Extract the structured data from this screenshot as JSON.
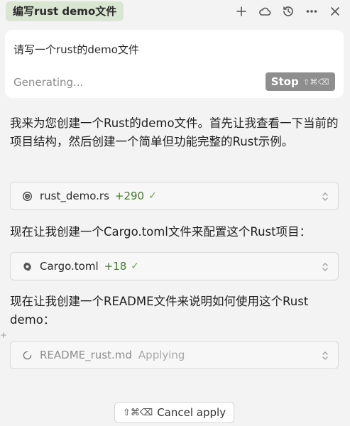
{
  "header": {
    "title": "编写rust demo文件",
    "icons": [
      "plus-icon",
      "cloud-icon",
      "history-icon",
      "more-icon",
      "close-icon"
    ]
  },
  "prompt": {
    "text": "请写一个rust的demo文件",
    "status": "Generating...",
    "stop_label": "Stop",
    "stop_shortcut": "⇧⌘⌫"
  },
  "messages": [
    "我来为您创建一个Rust的demo文件。首先让我查看一下当前的项目结构，然后创建一个简单但功能完整的Rust示例。",
    "现在让我创建一个Cargo.toml文件来配置这个Rust项目：",
    "现在让我创建一个README文件来说明如何使用这个Rust demo："
  ],
  "files": [
    {
      "name": "rust_demo.rs",
      "diff": "+290",
      "check": "✓",
      "icon": "rust-icon"
    },
    {
      "name": "Cargo.toml",
      "diff": "+18",
      "check": "✓",
      "icon": "gear-icon"
    },
    {
      "name": "README_rust.md",
      "status": "Applying",
      "icon": "loading-icon"
    }
  ],
  "side_marker": "+",
  "cancel": {
    "shortcut": "⇧⌘⌫",
    "label": "Cancel apply"
  },
  "colors": {
    "title_tab_bg": "#d9e6d1",
    "diff_green": "#3f7d2b",
    "stop_bg": "#8e8e8e"
  }
}
